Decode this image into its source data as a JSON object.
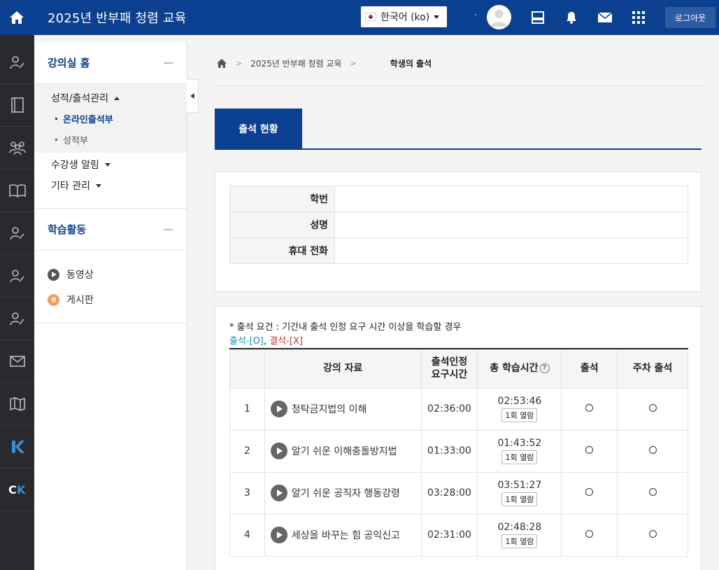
{
  "header": {
    "course_title": "2025년 반부패 청렴 교육",
    "language": "한국어 (ko)",
    "logout_label": "로그아웃"
  },
  "rail": {
    "icons": [
      "person-edit-icon",
      "notebook-icon",
      "group-icon",
      "open-book-icon",
      "person-edit-icon",
      "person-edit-icon",
      "person-edit-icon",
      "mail-icon",
      "map-icon",
      "k-logo-icon",
      "ck-logo-icon"
    ]
  },
  "sidebar": {
    "section1_title": "강의실 홈",
    "group_title": "성적/출석관리",
    "sub_items": [
      "온라인출석부",
      "성적부"
    ],
    "links": [
      "수강생 알림",
      "기타 관리"
    ],
    "section2_title": "학습활동",
    "activities": [
      "동영상",
      "게시판"
    ]
  },
  "breadcrumb": {
    "course": "2025년 반부패 청렴 교육",
    "current": "학생의 출석"
  },
  "tab": {
    "label": "출석 현황"
  },
  "student_info": {
    "labels": [
      "학번",
      "성명",
      "휴대 전화"
    ],
    "values": [
      "",
      "",
      ""
    ]
  },
  "attendance": {
    "requirement": "* 출석 요건 : 기간내 출석 인정 요구 시간 이상을 학습할 경우",
    "legend_present": "출석-[O]",
    "legend_sep": ",",
    "legend_absent": "결석-[X]",
    "headers": {
      "material": "강의 자료",
      "required_line1": "출석인정",
      "required_line2": "요구시간",
      "total": "총 학습시간",
      "help": "?",
      "attend": "출석",
      "weekly": "주차 출석"
    },
    "view_label": "1회 열람",
    "rows": [
      {
        "no": "1",
        "title": "청탁금지법의 이해",
        "required": "02:36:00",
        "total": "02:53:46",
        "attend": "O",
        "weekly": "O"
      },
      {
        "no": "2",
        "title": "알기 쉬운 이해충돌방지법",
        "required": "01:33:00",
        "total": "01:43:52",
        "attend": "O",
        "weekly": "O"
      },
      {
        "no": "3",
        "title": "알기 쉬운 공직자 행동강령",
        "required": "03:28:00",
        "total": "03:51:27",
        "attend": "O",
        "weekly": "O"
      },
      {
        "no": "4",
        "title": "세상을 바꾸는 힘 공익신고",
        "required": "02:31:00",
        "total": "02:48:28",
        "attend": "O",
        "weekly": "O"
      }
    ]
  },
  "colors": {
    "brand": "#0b3f8f",
    "rail": "#2a2a2e",
    "present": "#1b8fb8",
    "absent": "#c0392b",
    "board_icon": "#f0a060"
  }
}
